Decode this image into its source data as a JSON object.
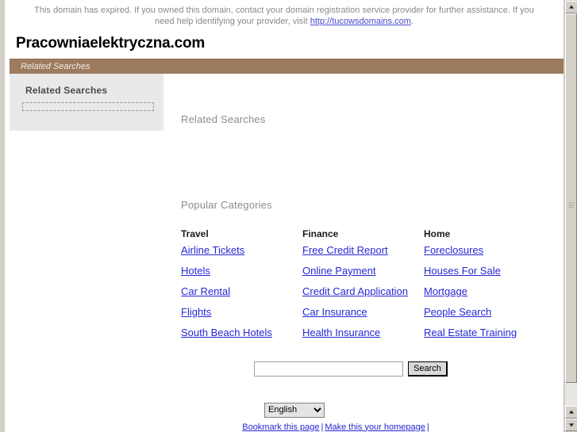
{
  "notice": {
    "text_before": "This domain has expired. If you owned this domain, contact your domain registration service provider for further assistance. If you need help identifying your provider, visit ",
    "link_text": "http://tucowsdomains.com",
    "text_after": "."
  },
  "domain": {
    "title": "Pracowniaelektryczna.com"
  },
  "brownbar": {
    "label": "Related Searches"
  },
  "sidebar": {
    "heading": "Related Searches"
  },
  "main": {
    "related_heading": "Related Searches",
    "popular_heading": "Popular Categories"
  },
  "categories": [
    {
      "title": "Travel",
      "links": [
        "Airline Tickets",
        "Hotels",
        "Car Rental",
        "Flights",
        "South Beach Hotels"
      ]
    },
    {
      "title": "Finance",
      "links": [
        "Free Credit Report",
        "Online Payment",
        "Credit Card Application",
        "Car Insurance",
        "Health Insurance"
      ]
    },
    {
      "title": "Home",
      "links": [
        "Foreclosures",
        "Houses For Sale",
        "Mortgage",
        "People Search",
        "Real Estate Training"
      ]
    }
  ],
  "search": {
    "value": "",
    "placeholder": "",
    "button_label": "Search"
  },
  "language": {
    "selected": "English",
    "options": [
      "English"
    ]
  },
  "footer": {
    "bookmark_label": "Bookmark this page",
    "separator": "|",
    "homepage_label": "Make this your homepage",
    "trailing_separator": "|"
  },
  "colors": {
    "accent_brown": "#9d7b5f",
    "link_blue": "#2727d6",
    "heading_gray": "#8c8c8c",
    "sidebar_bg": "#e9e9e9"
  },
  "scrollbar": {
    "up_icon": "triangle-up",
    "down_icon": "triangle-down"
  }
}
